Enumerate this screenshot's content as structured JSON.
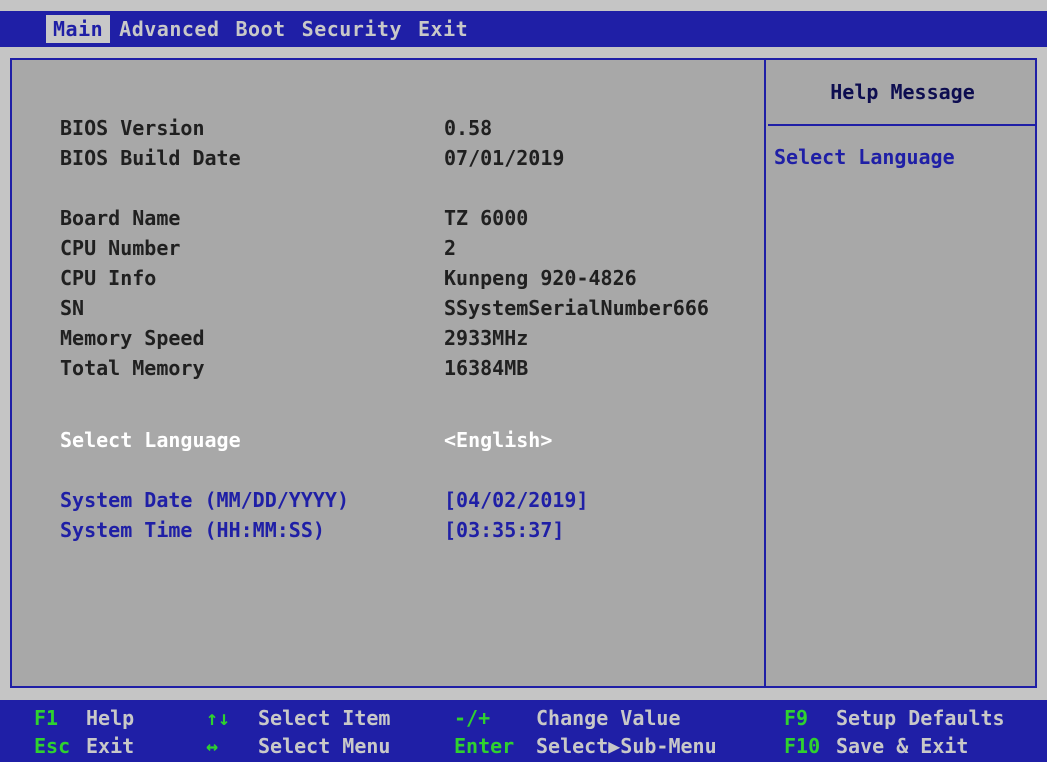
{
  "menu": {
    "tabs": [
      {
        "label": "Main"
      },
      {
        "label": "Advanced"
      },
      {
        "label": "Boot"
      },
      {
        "label": "Security"
      },
      {
        "label": "Exit"
      }
    ]
  },
  "info": {
    "bios_version": {
      "label": "BIOS Version",
      "value": "0.58"
    },
    "bios_build_date": {
      "label": "BIOS Build Date",
      "value": "07/01/2019"
    },
    "board_name": {
      "label": "Board Name",
      "value": "TZ 6000"
    },
    "cpu_number": {
      "label": "CPU Number",
      "value": "2"
    },
    "cpu_info": {
      "label": "CPU Info",
      "value": "Kunpeng 920-4826"
    },
    "sn": {
      "label": "SN",
      "value": "SSystemSerialNumber666"
    },
    "memory_speed": {
      "label": "Memory Speed",
      "value": "2933MHz"
    },
    "total_memory": {
      "label": "Total Memory",
      "value": "16384MB"
    }
  },
  "settings": {
    "language": {
      "label": "Select Language",
      "value": "<English>"
    },
    "date": {
      "label": "System Date (MM/DD/YYYY)",
      "value": "[04/02/2019]"
    },
    "time": {
      "label": "System Time (HH:MM:SS)",
      "value": "[03:35:37]"
    }
  },
  "help": {
    "title": "Help Message",
    "text": "Select Language"
  },
  "footer": {
    "f1": {
      "key": "F1",
      "desc": "Help"
    },
    "esc": {
      "key": "Esc",
      "desc": "Exit"
    },
    "updown": {
      "key": "↑↓",
      "desc": "Select Item"
    },
    "leftright": {
      "key": "↔",
      "desc": "Select Menu"
    },
    "minusplus": {
      "key": "-/+",
      "desc": "Change Value"
    },
    "enter": {
      "key": "Enter",
      "desc": "Select▶Sub-Menu"
    },
    "f9": {
      "key": "F9",
      "desc": "Setup Defaults"
    },
    "f10": {
      "key": "F10",
      "desc": "Save & Exit"
    }
  },
  "colors": {
    "bar_blue": "#1f1fa6",
    "panel_gray": "#a8a8a8",
    "key_green": "#2fd12f",
    "selected_white": "#ffffff"
  }
}
